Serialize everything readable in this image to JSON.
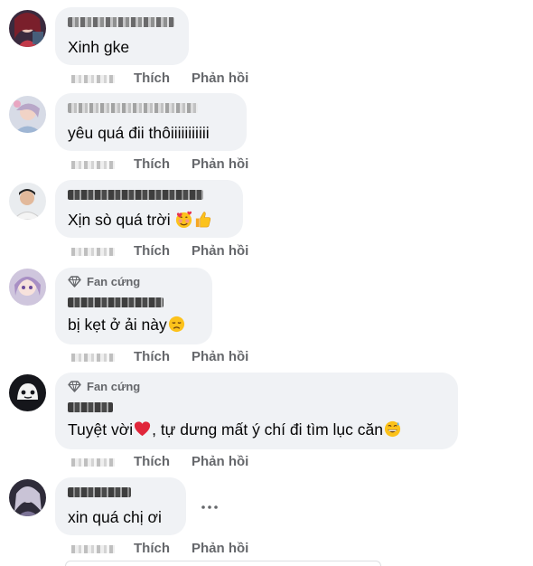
{
  "actions": {
    "like_label": "Thích",
    "reply_label": "Phản hồi"
  },
  "badge_label": "Fan cứng",
  "comments": [
    {
      "text": "Xinh gke",
      "text_suffix": ""
    },
    {
      "text": "yêu quá đii thôiiiiiiiiiii",
      "text_suffix": ""
    },
    {
      "text": "Xịn sò quá trời ",
      "text_suffix": ""
    },
    {
      "text": "bị kẹt ở ải này",
      "text_suffix": ""
    },
    {
      "text": "Tuyệt vời",
      "text_suffix": ", tự dưng mất ý chí đi tìm lục căn"
    },
    {
      "text": "xin quá chị ơi",
      "text_suffix": ""
    }
  ],
  "icons": {
    "badge": "diamond-icon",
    "more": "more-horizontal-icon",
    "emoji_smiling_hearts": "smiling-face-with-hearts-icon",
    "emoji_thumbs_up": "thumbs-up-icon",
    "emoji_disappointed": "disappointed-face-icon",
    "emoji_heart": "red-heart-icon",
    "emoji_grinning_sweat": "grinning-face-with-sweat-icon"
  },
  "colors": {
    "bubble": "#f0f2f5",
    "secondary_text": "#65676b",
    "primary_text": "#050505"
  }
}
